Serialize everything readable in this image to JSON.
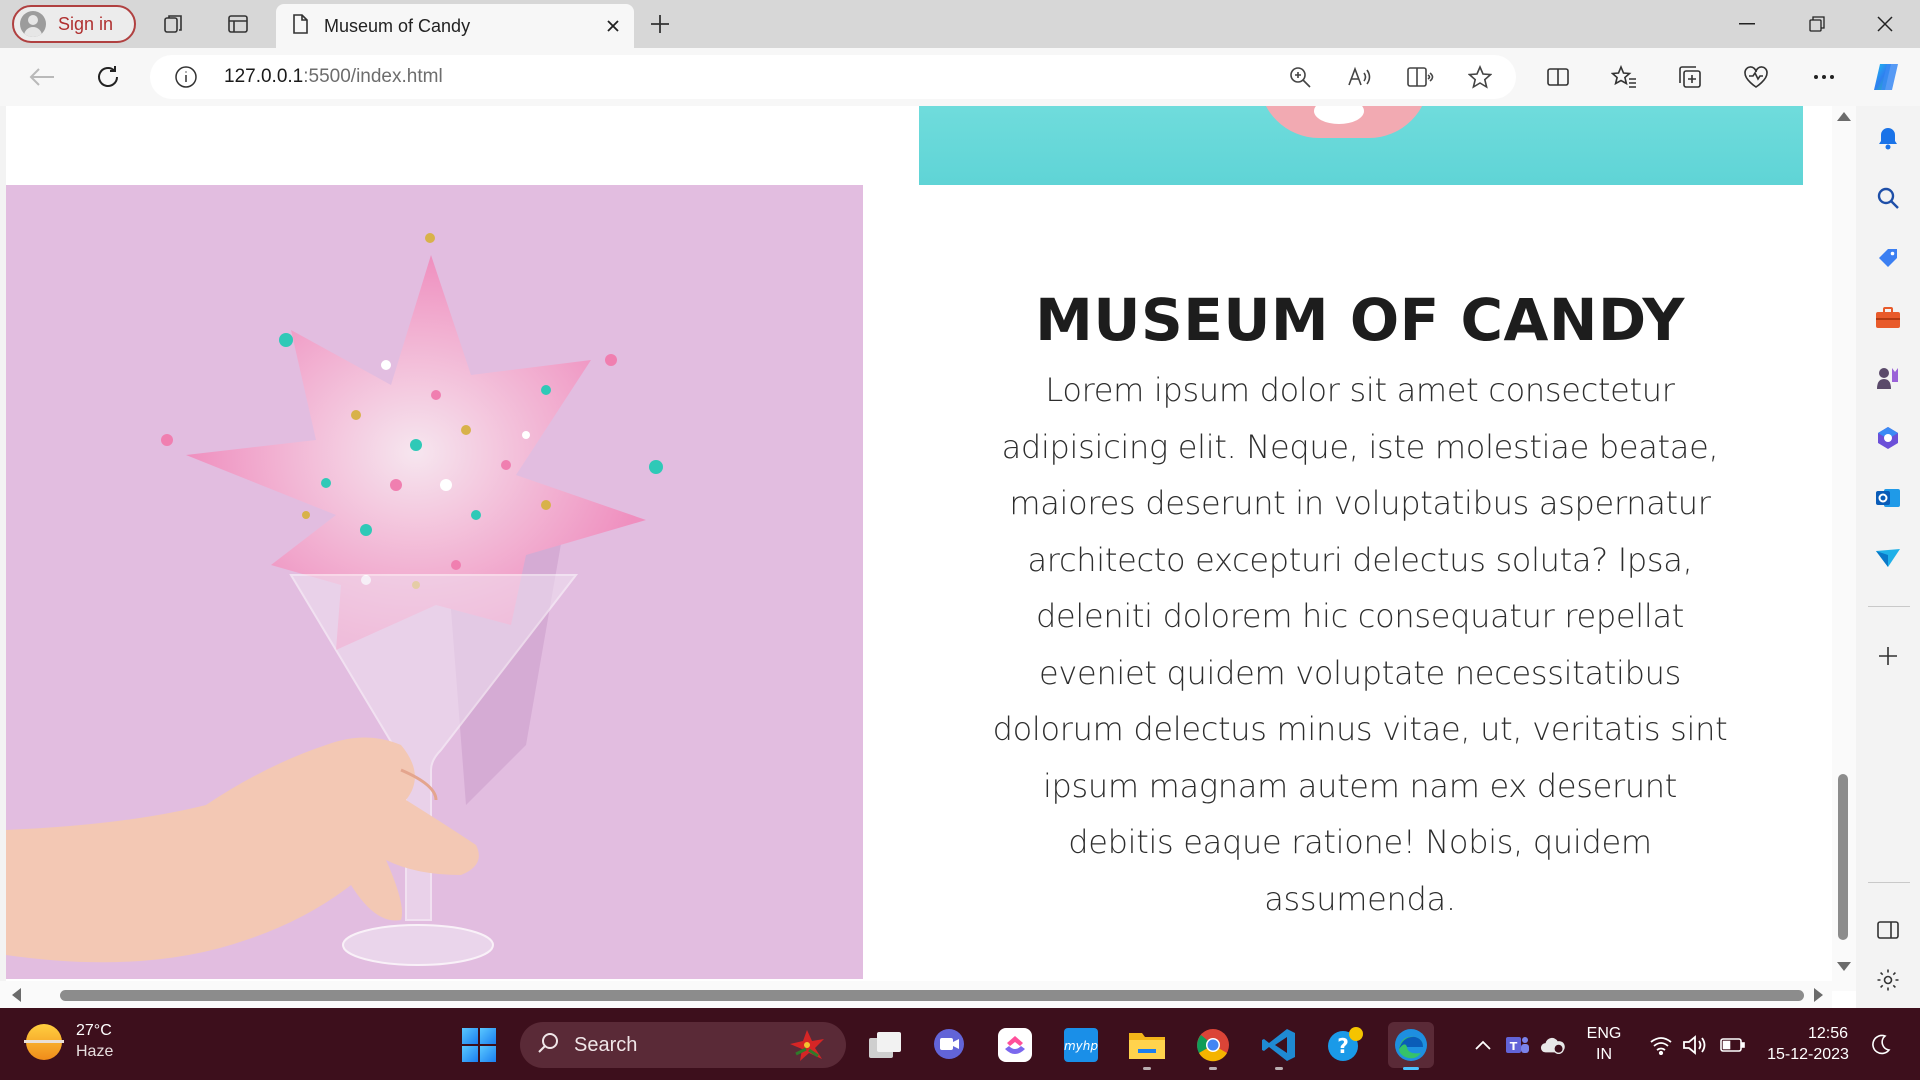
{
  "browser": {
    "signin_label": "Sign in",
    "tab_title": "Museum of Candy",
    "url_host": "127.0.0.1",
    "url_path": ":5500/index.html"
  },
  "page": {
    "heading": "MUSEUM OF CANDY",
    "paragraph_lines": [
      "Lorem ipsum dolor sit amet consectetur",
      "adipisicing elit. Neque, iste molestiae beatae,",
      "maiores deserunt in voluptatibus aspernatur",
      "architecto excepturi delectus soluta? Ipsa,",
      "deleniti dolorem hic consequatur repellat",
      "eveniet quidem voluptate necessitatibus",
      "dolorum delectus minus vitae, ut, veritatis sint",
      "ipsum magnam autem nam ex deserunt",
      "debitis eaque ratione! Nobis, quidem",
      "assumenda."
    ]
  },
  "taskbar": {
    "weather_temp": "27°C",
    "weather_cond": "Haze",
    "search_label": "Search",
    "lang_line1": "ENG",
    "lang_line2": "IN",
    "time": "12:56",
    "date": "15-12-2023"
  },
  "colors": {
    "candy_bg": "#e2bde0",
    "hero_teal": "#66d8d8",
    "taskbar_bg": "#3d0f1c",
    "signin_accent": "#b03030"
  }
}
